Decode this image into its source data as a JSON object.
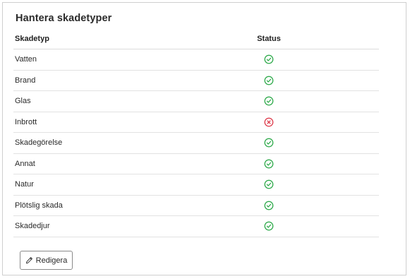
{
  "card": {
    "title": "Hantera skadetyper"
  },
  "table": {
    "columns": {
      "type": "Skadetyp",
      "status": "Status"
    },
    "rows": [
      {
        "name": "Vatten",
        "status": "active"
      },
      {
        "name": "Brand",
        "status": "active"
      },
      {
        "name": "Glas",
        "status": "active"
      },
      {
        "name": "Inbrott",
        "status": "inactive"
      },
      {
        "name": "Skadegörelse",
        "status": "active"
      },
      {
        "name": "Annat",
        "status": "active"
      },
      {
        "name": "Natur",
        "status": "active"
      },
      {
        "name": "Plötslig skada",
        "status": "active"
      },
      {
        "name": "Skadedjur",
        "status": "active"
      }
    ]
  },
  "icons": {
    "active": "check-circle-icon",
    "inactive": "x-circle-icon",
    "edit": "pencil-icon"
  },
  "colors": {
    "active": "#28a745",
    "inactive": "#dc3545"
  },
  "actions": {
    "edit_label": "Redigera"
  }
}
